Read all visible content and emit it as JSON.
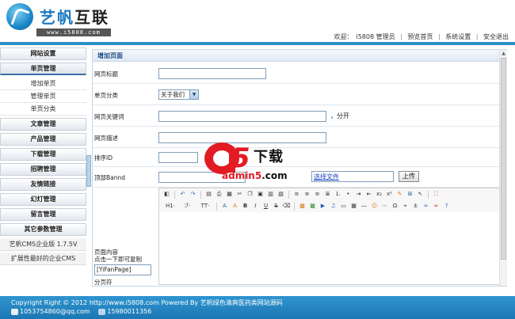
{
  "header": {
    "logo_cn": "艺帆",
    "logo_cn2": "互联",
    "logo_url": "www.i5808.com",
    "welcome": "欢迎：",
    "user": "i5808 管理员",
    "nav": [
      "预览首页",
      "系统设置",
      "安全退出"
    ]
  },
  "sidebar": {
    "items": [
      {
        "label": "网站设置"
      },
      {
        "label": "单页管理"
      },
      {
        "label": "文章管理"
      },
      {
        "label": "产品管理"
      },
      {
        "label": "下载管理"
      },
      {
        "label": "招聘管理"
      },
      {
        "label": "友情链接"
      },
      {
        "label": "幻灯管理"
      },
      {
        "label": "留言管理"
      },
      {
        "label": "其它参数管理"
      }
    ],
    "sub_items": [
      "增加单页",
      "管理单页",
      "单页分类"
    ],
    "version": "艺帆CMS企业版 1.7.5V",
    "slogan": "扩展性最好的企业CMS"
  },
  "panel": {
    "title": "增加页面",
    "fields": {
      "page_title_label": "网页标题",
      "category_label": "单页分类",
      "category_value": "关于我们",
      "keywords_label": "网页关键词",
      "keywords_hint": "，分开",
      "description_label": "网页描述",
      "order_label": "排序ID",
      "banner_label": "顶部Bannd",
      "choose_file": "选择文件",
      "upload_btn": "上传",
      "content_label_1": "页面内容",
      "content_label_2": "点击一下即可复制",
      "copy_code": "[YiFanPage]",
      "page_sep": "分页符"
    },
    "editor_toolbar": {
      "heading": "H1·",
      "font": "ℱ·",
      "size": "TT·"
    }
  },
  "watermark": {
    "digit": "5",
    "cn": "下载",
    "site": "admin5",
    "tld": ".com"
  },
  "footer": {
    "copyright": "Copyright Right © 2012 http://www.i5808.com Powered By 艺帆绿色清爽医药类网站源码",
    "email": "1053754860@qq.com",
    "phone": "15980011356"
  }
}
